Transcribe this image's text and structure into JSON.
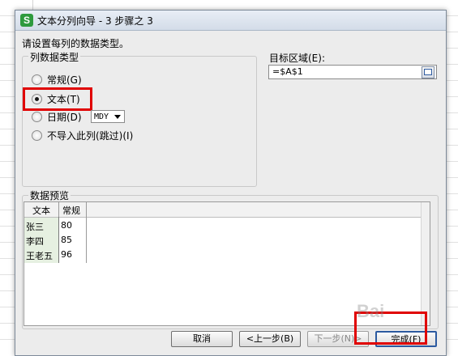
{
  "window": {
    "title": "文本分列向导 - 3 步骤之 3",
    "icon_letter": "S"
  },
  "heading": "请设置每列的数据类型。",
  "column_type": {
    "legend": "列数据类型",
    "options": [
      {
        "label": "常规(G)",
        "checked": false
      },
      {
        "label": "文本(T)",
        "checked": true
      },
      {
        "label": "日期(D)",
        "checked": false
      },
      {
        "label": "不导入此列(跳过)(I)",
        "checked": false
      }
    ],
    "date_format": "MDY"
  },
  "target": {
    "label": "目标区域(E):",
    "value": "=$A$1"
  },
  "preview": {
    "legend": "数据预览",
    "headers": [
      "文本",
      "常规"
    ],
    "rows": [
      [
        "张三",
        "80"
      ],
      [
        "李四",
        "85"
      ],
      [
        "王老五",
        "96"
      ]
    ]
  },
  "buttons": {
    "cancel": "取消",
    "back": "<上一步(B)",
    "next": "下一步(N)>",
    "finish": "完成(F)"
  },
  "watermark": "Bai"
}
